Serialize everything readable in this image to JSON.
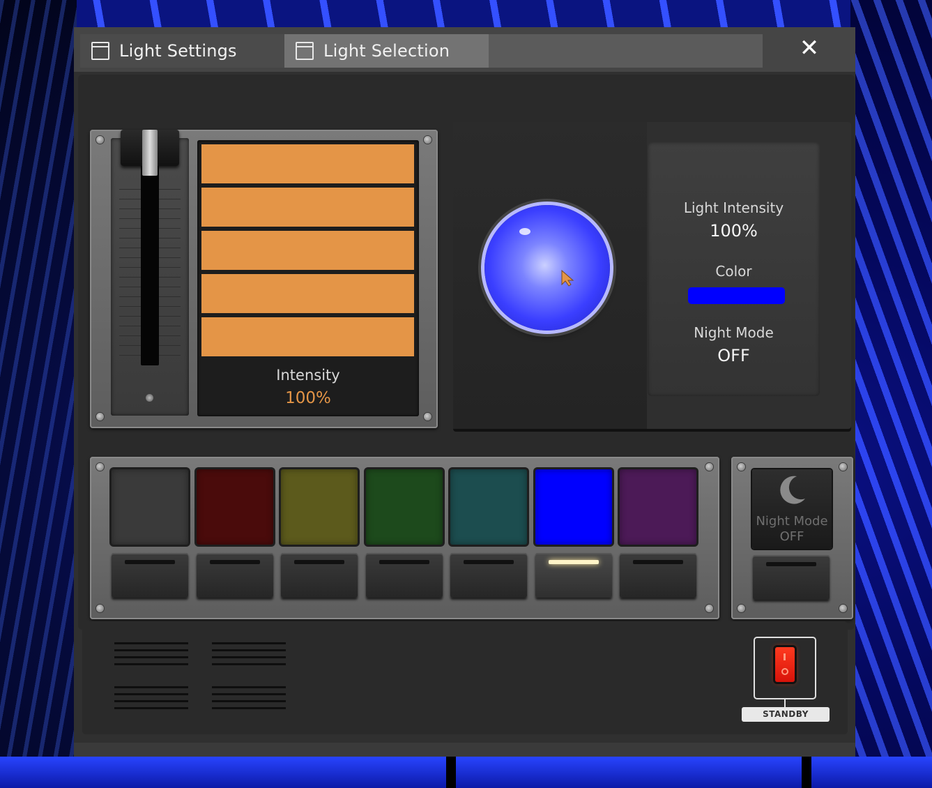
{
  "tabs": [
    {
      "label": "Light Settings"
    },
    {
      "label": "Light Selection"
    }
  ],
  "close_label": "✕",
  "intensity": {
    "label": "Intensity",
    "value": "100%",
    "slider_level": 1.0,
    "bar_count": 5,
    "bar_color": "#e49547"
  },
  "status": {
    "light_intensity_label": "Light Intensity",
    "light_intensity_value": "100%",
    "color_label": "Color",
    "color_value": "#0000ff",
    "night_mode_label": "Night Mode",
    "night_mode_value": "OFF"
  },
  "color_options": [
    {
      "name": "gray",
      "color": "#3a3a3a",
      "selected": false
    },
    {
      "name": "red",
      "color": "#4a0b0b",
      "selected": false
    },
    {
      "name": "yellow",
      "color": "#5c5a1c",
      "selected": false
    },
    {
      "name": "green",
      "color": "#1d4a1c",
      "selected": false
    },
    {
      "name": "teal",
      "color": "#1c4d4f",
      "selected": false
    },
    {
      "name": "blue",
      "color": "#0000ff",
      "selected": true
    },
    {
      "name": "purple",
      "color": "#4c1a57",
      "selected": false
    }
  ],
  "night_mode_button": {
    "icon": "moon-icon",
    "line1": "Night Mode",
    "line2": "OFF"
  },
  "standby": {
    "label": "STANDBY",
    "icon": "power-rocker-switch"
  }
}
